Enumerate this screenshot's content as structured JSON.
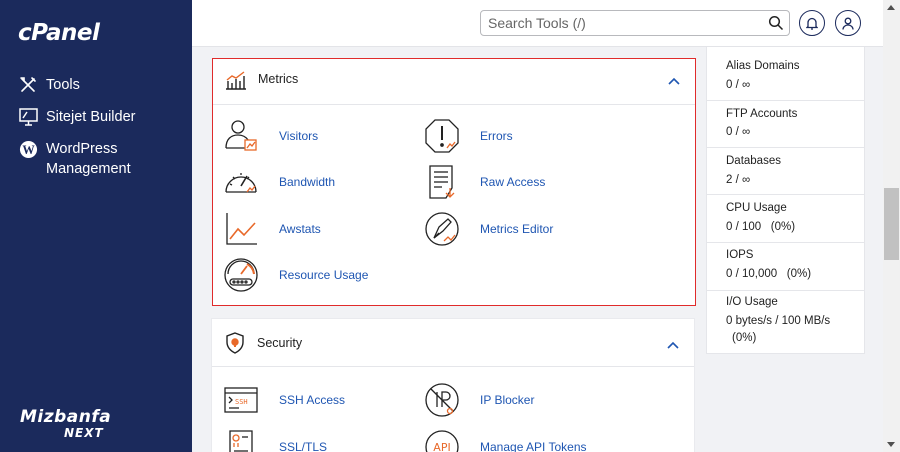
{
  "sidebar": {
    "logo": "cPanel",
    "items": [
      {
        "label": "Tools",
        "icon": "tools-icon"
      },
      {
        "label": "Sitejet Builder",
        "icon": "monitor-icon"
      },
      {
        "label": "WordPress Management",
        "line1": "WordPress",
        "line2": "Management",
        "icon": "wordpress-icon"
      }
    ],
    "brand_line1": "Mizbanfa",
    "brand_line2": "NEXT"
  },
  "header": {
    "search_placeholder": "Search Tools (/)",
    "icons": [
      "search-icon",
      "bell-icon",
      "user-icon"
    ]
  },
  "metrics": {
    "title": "Metrics",
    "tools": [
      {
        "label": "Visitors",
        "icon": "visitors-icon"
      },
      {
        "label": "Errors",
        "icon": "errors-icon"
      },
      {
        "label": "Bandwidth",
        "icon": "bandwidth-icon"
      },
      {
        "label": "Raw Access",
        "icon": "raw-access-icon"
      },
      {
        "label": "Awstats",
        "icon": "awstats-icon"
      },
      {
        "label": "Metrics Editor",
        "icon": "metrics-editor-icon"
      },
      {
        "label": "Resource Usage",
        "icon": "resource-usage-icon"
      }
    ]
  },
  "security": {
    "title": "Security",
    "tools": [
      {
        "label": "SSH Access",
        "icon": "ssh-access-icon"
      },
      {
        "label": "IP Blocker",
        "icon": "ip-blocker-icon"
      },
      {
        "label": "SSL/TLS",
        "icon": "ssl-tls-icon"
      },
      {
        "label": "Manage API Tokens",
        "icon": "api-tokens-icon"
      }
    ]
  },
  "stats": [
    {
      "label": "Alias Domains",
      "value": "0 / ∞"
    },
    {
      "label": "FTP Accounts",
      "value": "0 / ∞"
    },
    {
      "label": "Databases",
      "value": "2 / ∞"
    },
    {
      "label": "CPU Usage",
      "value": "0 / 100   (0%)"
    },
    {
      "label": "IOPS",
      "value": "0 / 10,000   (0%)"
    },
    {
      "label": "I/O Usage",
      "value": "0 bytes/s / 100 MB/s",
      "value2": "(0%)"
    }
  ],
  "colors": {
    "sidebar": "#1b2a5c",
    "link": "#1f56b2",
    "accent": "#e8692a",
    "active_border": "#e02b2b"
  }
}
